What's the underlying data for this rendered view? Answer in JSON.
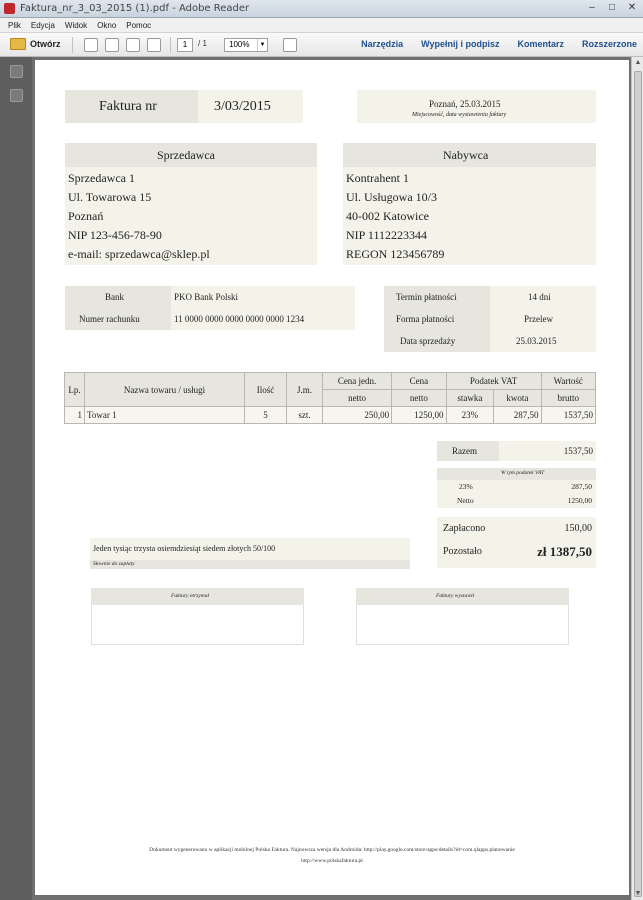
{
  "window": {
    "title": "Faktura_nr_3_03_2015 (1).pdf - Adobe Reader"
  },
  "menu": [
    "Plik",
    "Edycja",
    "Widok",
    "Okno",
    "Pomoc"
  ],
  "toolbar": {
    "open_label": "Otwórz",
    "page_current": "1",
    "page_total": "/ 1",
    "zoom": "100%",
    "links": [
      "Narzędzia",
      "Wypełnij i podpisz",
      "Komentarz",
      "Rozszerzone"
    ]
  },
  "invoice": {
    "title_label": "Faktura nr",
    "number": "3/03/2015",
    "place_date": "Poznań, 25.03.2015",
    "place_date_caption": "Miejscowość, data wystawienia faktury",
    "seller": {
      "header": "Sprzedawca",
      "lines": [
        "Sprzedawca 1",
        "Ul. Towarowa 15",
        "Poznań",
        "NIP 123-456-78-90",
        "e-mail: sprzedawca@sklep.pl"
      ]
    },
    "buyer": {
      "header": "Nabywca",
      "lines": [
        "Kontrahent 1",
        "Ul. Usługowa 10/3",
        "40-002 Katowice",
        "NIP 1112223344",
        "REGON 123456789"
      ]
    },
    "bank": {
      "bank_label": "Bank",
      "bank_value": "PKO Bank Polski",
      "account_label": "Numer rachunku",
      "account_value": "11 0000 0000 0000 0000 0000 1234"
    },
    "payment": {
      "term_label": "Termin płatności",
      "term_value": "14 dni",
      "form_label": "Forma płatności",
      "form_value": "Przelew",
      "sale_date_label": "Data sprzedaży",
      "sale_date_value": "25.03.2015"
    },
    "table": {
      "h_lp": "Lp.",
      "h_name": "Nazwa towaru / usługi",
      "h_qty": "Ilość",
      "h_unit": "J.m.",
      "h_price_1": "Cena jedn.",
      "h_price_2": "netto",
      "h_net_1": "Cena",
      "h_net_2": "netto",
      "h_vat": "Podatek VAT",
      "h_vat_rate": "stawka",
      "h_vat_amount": "kwota",
      "h_gross_1": "Wartość",
      "h_gross_2": "brutto",
      "rows": [
        {
          "lp": "1",
          "name": "Towar 1",
          "qty": "5",
          "unit": "szt.",
          "price": "250,00",
          "net": "1250,00",
          "rate": "23%",
          "vat": "287,50",
          "gross": "1537,50"
        }
      ]
    },
    "totals": {
      "sum_label": "Razem",
      "sum_value": "1537,50",
      "vat_header": "W tym podatek VAT",
      "vat_rate": "23%",
      "vat_amount": "287,50",
      "net_label": "Netto",
      "net_value": "1250,00",
      "paid_label": "Zapłacono",
      "paid_value": "150,00",
      "remaining_label": "Pozostało",
      "remaining_value": "zł 1387,50"
    },
    "amount_words": "Jeden tysiąc trzysta osiemdziesiąt siedem złotych 50/100",
    "amount_words_caption": "Słownie do zapłaty",
    "signature_received": "Faktury otrzymał",
    "signature_issued": "Faktury wystawił",
    "footer_line1": "Dokument wygenerowano w aplikacji mobilnej Polska Faktura. Najnowsza wersja dla Androida: http://play.google.com/store/apps/details?id=com.qlapps.planowanie",
    "footer_line2": "http://www.polskafaktura.pl"
  },
  "colors": {
    "cell_bg": "#f4f3ea",
    "header_bg": "#e6e5de",
    "link_blue": "#1f4f8f"
  }
}
